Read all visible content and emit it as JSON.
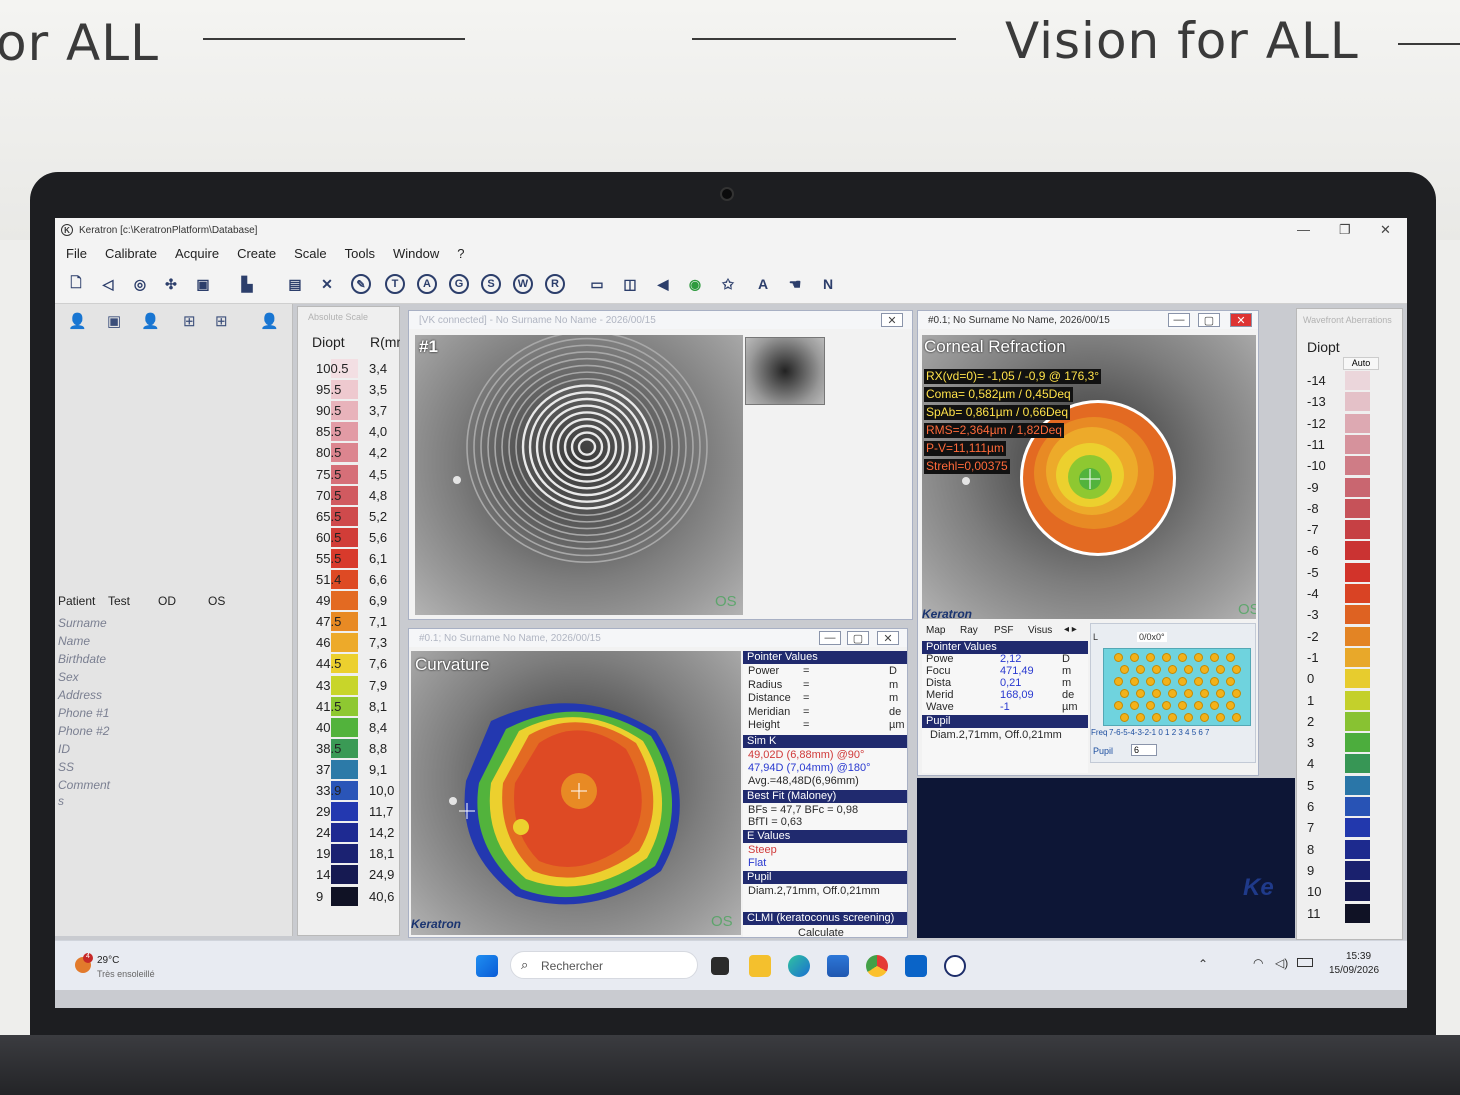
{
  "wall": {
    "slogan_left": "or ALL",
    "slogan_right": "Vision for ALL"
  },
  "app": {
    "title": "Keratron [c:\\KeratronPlatform\\Database]",
    "menu": [
      "File",
      "Calibrate",
      "Acquire",
      "Create",
      "Scale",
      "Tools",
      "Window",
      "?"
    ],
    "toolbar_letters": [
      "T",
      "A",
      "G",
      "S",
      "W",
      "R"
    ],
    "toolbar_text": [
      "A",
      "N"
    ]
  },
  "patient": {
    "label": "Patient",
    "value": "Test",
    "od": "OD",
    "os": "OS",
    "fields": [
      "Surname",
      "Name",
      "Birthdate",
      "Sex",
      "Address",
      "Phone #1",
      "Phone #2",
      "ID",
      "SS",
      "Comment",
      "s"
    ]
  },
  "abs_scale": {
    "header": "Absolute Scale",
    "col_diopt": "Diopt",
    "col_r": "R(mm)",
    "rows": [
      {
        "d": "100.5",
        "r": "3,4",
        "c": "#f3dfe3"
      },
      {
        "d": "95.5",
        "r": "3,5",
        "c": "#eec9cf"
      },
      {
        "d": "90.5",
        "r": "3,7",
        "c": "#e8b3bb"
      },
      {
        "d": "85.5",
        "r": "4,0",
        "c": "#e29ba5"
      },
      {
        "d": "80.5",
        "r": "4,2",
        "c": "#dc858f"
      },
      {
        "d": "75.5",
        "r": "4,5",
        "c": "#d66f78"
      },
      {
        "d": "70.5",
        "r": "4,8",
        "c": "#d15a60"
      },
      {
        "d": "65.5",
        "r": "5,2",
        "c": "#cf4a4c"
      },
      {
        "d": "60.5",
        "r": "5,6",
        "c": "#d13d38"
      },
      {
        "d": "55.5",
        "r": "6,1",
        "c": "#d83a2c"
      },
      {
        "d": "51.4",
        "r": "6,6",
        "c": "#de4a24"
      },
      {
        "d": "49",
        "r": "6,9",
        "c": "#e36a22"
      },
      {
        "d": "47.5",
        "r": "7,1",
        "c": "#e88a24"
      },
      {
        "d": "46",
        "r": "7,3",
        "c": "#edaa2a"
      },
      {
        "d": "44.5",
        "r": "7,6",
        "c": "#ecd02e"
      },
      {
        "d": "43",
        "r": "7,9",
        "c": "#c8d52a"
      },
      {
        "d": "41.5",
        "r": "8,1",
        "c": "#8ec831"
      },
      {
        "d": "40",
        "r": "8,4",
        "c": "#52b33c"
      },
      {
        "d": "38.5",
        "r": "8,8",
        "c": "#3a9a55"
      },
      {
        "d": "37",
        "r": "9,1",
        "c": "#2c7aa8"
      },
      {
        "d": "33.9",
        "r": "10,0",
        "c": "#2a55b8"
      },
      {
        "d": "29",
        "r": "11,7",
        "c": "#2338b0"
      },
      {
        "d": "24",
        "r": "14,2",
        "c": "#1e2a92"
      },
      {
        "d": "19",
        "r": "18,1",
        "c": "#1b2272"
      },
      {
        "d": "14",
        "r": "24,9",
        "c": "#161a52"
      },
      {
        "d": "9",
        "r": "40,6",
        "c": "#101225"
      }
    ]
  },
  "panel_vk": {
    "header": "[VK connected] - No Surname No Name - 2026/00/15",
    "title": "#1",
    "os": "OS"
  },
  "panel_curv": {
    "header": "#0.1; No Surname No Name, 2026/00/15",
    "title": "Curvature",
    "brand": "Keratron",
    "os": "OS",
    "pointer_header": "Pointer Values",
    "pointer_rows": [
      {
        "k": "Power",
        "v": "=",
        "u": "D"
      },
      {
        "k": "Radius",
        "v": "=",
        "u": "m"
      },
      {
        "k": "Distance",
        "v": "=",
        "u": "m"
      },
      {
        "k": "Meridian",
        "v": "=",
        "u": "de"
      },
      {
        "k": "Height",
        "v": "=",
        "u": "µm"
      }
    ],
    "simk_header": "Sim K",
    "simk1": "49,02D (6,88mm) @90°",
    "simk2": "47,94D (7,04mm) @180°",
    "simk_avg": "Avg.=48,48D(6,96mm)",
    "bestfit_header": "Best Fit (Maloney)",
    "bestfit1": "BFs = 47,7 BFc = 0,98",
    "bestfit2": "BfTI = 0,63",
    "evalues_header": "E Values",
    "steep": "Steep",
    "flat": "Flat",
    "pupil_header": "Pupil",
    "pupil_diam": "Diam.2,71mm, Off.0,21mm",
    "clmi_header": "CLMI (keratoconus screening)",
    "calc": "Calculate"
  },
  "panel_refr": {
    "header": "#0.1; No Surname No Name, 2026/00/15",
    "title": "Corneal Refraction",
    "brand": "Keratron",
    "os": "OS",
    "lines": [
      "RX(vd=0)= -1,05 / -0,9 @ 176,3°",
      "Coma= 0,582µm / 0,45Deq",
      "SpAb= 0,861µm / 0,66Deq",
      "RMS=2,364µm / 1,82Deq",
      "P-V=11,111µm",
      "Strehl=0,00375"
    ],
    "line_colors": [
      "#ffe24a",
      "#ffe24a",
      "#ffe24a",
      "#ff6a3a",
      "#ff6a3a",
      "#ff6a3a"
    ],
    "tabs": [
      "Map",
      "Ray",
      "PSF",
      "Visus"
    ],
    "pointer_header": "Pointer Values",
    "pointer_rows": [
      {
        "k": "Powe",
        "v": "2,12",
        "u": "D"
      },
      {
        "k": "Focu",
        "v": "471,49",
        "u": "m"
      },
      {
        "k": "Dista",
        "v": "0,21",
        "u": "m"
      },
      {
        "k": "Merid",
        "v": "168,09",
        "u": "de"
      },
      {
        "k": "Wave",
        "v": "-1",
        "u": "µm"
      }
    ],
    "pupil_header": "Pupil",
    "pupil_diam": "Diam.2,71mm, Off.0,21mm",
    "lens_value": "0/0x0°",
    "freq_label": "Freq",
    "freq_scale": "7-6-5-4-3-2-1 0 1 2 3 4 5 6 7",
    "pupil_label": "Pupil",
    "pupil_value": "6"
  },
  "wf_scale": {
    "header": "Wavefront Aberrations",
    "col_diopt": "Diopt",
    "auto": "Auto",
    "rows": [
      {
        "d": "-14",
        "c": "#ebd6db"
      },
      {
        "d": "-13",
        "c": "#e4c1c8"
      },
      {
        "d": "-12",
        "c": "#dda9b2"
      },
      {
        "d": "-11",
        "c": "#d6929c"
      },
      {
        "d": "-10",
        "c": "#cf7c86"
      },
      {
        "d": "-9",
        "c": "#c96670"
      },
      {
        "d": "-8",
        "c": "#c65259"
      },
      {
        "d": "-7",
        "c": "#c64044"
      },
      {
        "d": "-6",
        "c": "#ca3332"
      },
      {
        "d": "-5",
        "c": "#d2332a"
      },
      {
        "d": "-4",
        "c": "#d94324"
      },
      {
        "d": "-3",
        "c": "#de6222"
      },
      {
        "d": "-2",
        "c": "#e38424"
      },
      {
        "d": "-1",
        "c": "#e8a82a"
      },
      {
        "d": "0",
        "c": "#e7cc2e"
      },
      {
        "d": "1",
        "c": "#c4d02b"
      },
      {
        "d": "2",
        "c": "#88c232"
      },
      {
        "d": "3",
        "c": "#4cad3d"
      },
      {
        "d": "4",
        "c": "#379655"
      },
      {
        "d": "5",
        "c": "#2a76a8"
      },
      {
        "d": "6",
        "c": "#2853b5"
      },
      {
        "d": "7",
        "c": "#2238ad"
      },
      {
        "d": "8",
        "c": "#1d2a8e"
      },
      {
        "d": "9",
        "c": "#1a216e"
      },
      {
        "d": "10",
        "c": "#151950"
      },
      {
        "d": "11",
        "c": "#101225"
      }
    ]
  },
  "taskbar": {
    "weather_temp": "29°C",
    "weather_desc": "Très ensoleillé",
    "weather_badge": "4",
    "search_placeholder": "Rechercher",
    "time": "15:39",
    "date": "15/09/2026"
  }
}
